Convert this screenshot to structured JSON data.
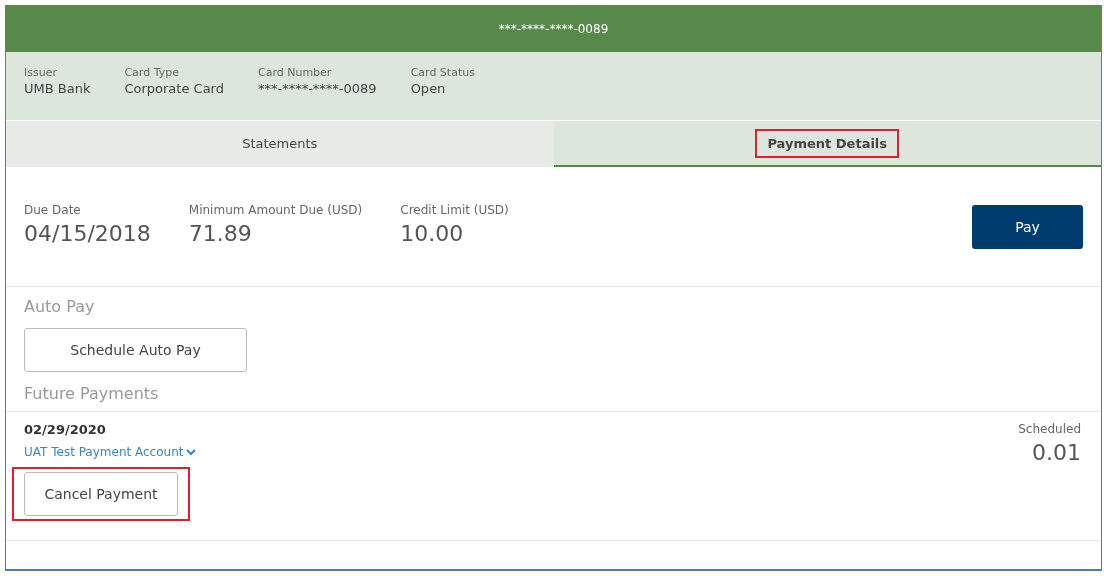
{
  "header": {
    "title": "***-****-****-0089"
  },
  "card_info": [
    {
      "label": "Issuer",
      "value": "UMB Bank"
    },
    {
      "label": "Card Type",
      "value": "Corporate Card"
    },
    {
      "label": "Card Number",
      "value": "***-****-****-0089"
    },
    {
      "label": "Card Status",
      "value": "Open"
    }
  ],
  "tabs": [
    {
      "label": "Statements",
      "selected": false,
      "highlighted": false
    },
    {
      "label": "Payment Details",
      "selected": true,
      "highlighted": true
    }
  ],
  "summary": [
    {
      "label": "Due Date",
      "value": "04/15/2018"
    },
    {
      "label": "Minimum Amount Due (USD)",
      "value": "71.89"
    },
    {
      "label": "Credit Limit (USD)",
      "value": "10.00"
    }
  ],
  "pay_button": "Pay",
  "auto_pay": {
    "title": "Auto Pay",
    "button": "Schedule Auto Pay"
  },
  "future_payments": {
    "title": "Future Payments",
    "items": [
      {
        "date": "02/29/2020",
        "account": "UAT Test Payment Account",
        "status": "Scheduled",
        "amount": "0.01",
        "cancel_button": "Cancel Payment",
        "highlighted": true
      }
    ]
  }
}
